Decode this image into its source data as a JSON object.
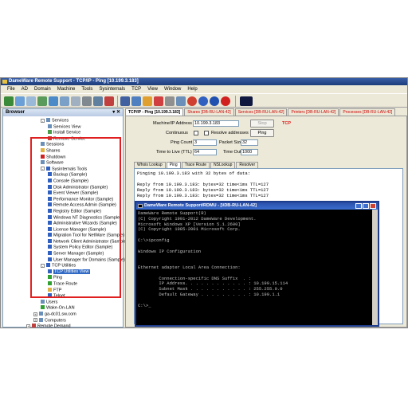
{
  "window": {
    "title": "DameWare Remote Support - TCP/IP - Ping [10.199.3.183]"
  },
  "menu": [
    "File",
    "AD",
    "Domain",
    "Machine",
    "Tools",
    "Sysinternals",
    "TCP",
    "View",
    "Window",
    "Help"
  ],
  "sidebar": {
    "title": "Browser",
    "pane_controls": "▾ ✕",
    "items": [
      {
        "label": "Services",
        "indent": 1,
        "expander": "-",
        "icon": "services-icon",
        "icon_color": "#6a8fb8"
      },
      {
        "label": "Services View",
        "indent": 2,
        "icon": "services-view-icon",
        "icon_color": "#6a8fb8"
      },
      {
        "label": "Install Service",
        "indent": 2,
        "icon": "install-service-icon",
        "icon_color": "#4a9a4a"
      },
      {
        "label": "Remove Service",
        "indent": 2,
        "icon": "remove-service-icon",
        "icon_color": "#c04040"
      },
      {
        "label": "Sessions",
        "indent": 1,
        "icon": "sessions-icon",
        "icon_color": "#6a8fb8"
      },
      {
        "label": "Shares",
        "indent": 1,
        "icon": "shares-icon",
        "icon_color": "#e0b040"
      },
      {
        "label": "Shutdown",
        "indent": 1,
        "icon": "shutdown-icon",
        "icon_color": "#d02020"
      },
      {
        "label": "Software",
        "indent": 1,
        "icon": "software-icon",
        "icon_color": "#6a8fb8"
      },
      {
        "label": "Sysinternals Tools",
        "indent": 1,
        "expander": "-",
        "icon": "sysinternals-icon",
        "icon_color": "#3060c0"
      },
      {
        "label": "Backup (Sample)",
        "indent": 2,
        "icon": "tool-icon",
        "icon_color": "#3060c0"
      },
      {
        "label": "Console (Sample)",
        "indent": 2,
        "icon": "tool-icon",
        "icon_color": "#3060c0"
      },
      {
        "label": "Disk Administrator (Sample)",
        "indent": 2,
        "icon": "tool-icon",
        "icon_color": "#3060c0"
      },
      {
        "label": "Event Viewer (Sample)",
        "indent": 2,
        "icon": "tool-icon",
        "icon_color": "#3060c0"
      },
      {
        "label": "Performance Monitor (Sample)",
        "indent": 2,
        "icon": "tool-icon",
        "icon_color": "#3060c0"
      },
      {
        "label": "Remote Access Admin (Sample)",
        "indent": 2,
        "icon": "tool-icon",
        "icon_color": "#3060c0"
      },
      {
        "label": "Registry Editor (Sample)",
        "indent": 2,
        "icon": "tool-icon",
        "icon_color": "#3060c0"
      },
      {
        "label": "Windows NT Diagnostics (Sample)",
        "indent": 2,
        "icon": "tool-icon",
        "icon_color": "#3060c0"
      },
      {
        "label": "Administrative Wizards (Sample)",
        "indent": 2,
        "icon": "tool-icon",
        "icon_color": "#3060c0"
      },
      {
        "label": "License Manager (Sample)",
        "indent": 2,
        "icon": "tool-icon",
        "icon_color": "#3060c0"
      },
      {
        "label": "Migration Tool for NetWare (Sample)",
        "indent": 2,
        "icon": "tool-icon",
        "icon_color": "#3060c0"
      },
      {
        "label": "Network Client Administrator (Sample)",
        "indent": 2,
        "icon": "tool-icon",
        "icon_color": "#3060c0"
      },
      {
        "label": "System Policy Editor (Sample)",
        "indent": 2,
        "icon": "tool-icon",
        "icon_color": "#3060c0"
      },
      {
        "label": "Server Manager (Sample)",
        "indent": 2,
        "icon": "tool-icon",
        "icon_color": "#3060c0"
      },
      {
        "label": "User Manager for Domains (Sample)",
        "indent": 2,
        "icon": "tool-icon",
        "icon_color": "#3060c0"
      },
      {
        "label": "TCP Utilities",
        "indent": 1,
        "expander": "-",
        "icon": "tcp-utilities-icon",
        "icon_color": "#3060c0"
      },
      {
        "label": "TCP Utilities View",
        "indent": 2,
        "icon": "tcp-view-icon",
        "icon_color": "#3060c0",
        "selected": true
      },
      {
        "label": "Ping",
        "indent": 2,
        "icon": "ping-icon",
        "icon_color": "#30a030"
      },
      {
        "label": "Trace Route",
        "indent": 2,
        "icon": "trace-route-icon",
        "icon_color": "#30a030"
      },
      {
        "label": "FTP",
        "indent": 2,
        "icon": "ftp-icon",
        "icon_color": "#e0b040"
      },
      {
        "label": "Telnet",
        "indent": 2,
        "icon": "telnet-icon",
        "icon_color": "#3060c0"
      },
      {
        "label": "Users",
        "indent": 1,
        "icon": "users-icon",
        "icon_color": "#6a8fb8"
      },
      {
        "label": "Wake-On-LAN",
        "indent": 1,
        "icon": "wake-on-lan-icon",
        "icon_color": "#30a030"
      },
      {
        "label": "ga-dc01.sw.com",
        "indent": 0,
        "expander": "+",
        "icon": "computer-icon",
        "icon_color": "#6a8fb8"
      },
      {
        "label": "Computers",
        "indent": 0,
        "expander": "+",
        "icon": "computers-icon",
        "icon_color": "#6a8fb8"
      },
      {
        "label": "Remote Demand",
        "indent": -1,
        "expander": "+",
        "icon": "remote-demand-icon",
        "icon_color": "#c04040"
      }
    ]
  },
  "tabs": [
    {
      "label": "TCP/IP - Ping [10.199.3.183]",
      "active": true
    },
    {
      "label": "Shares [DB-RU-LAN-42]"
    },
    {
      "label": "Services [DB-RU-LAN-42]"
    },
    {
      "label": "Printers [DB-RU-LAN-42]"
    },
    {
      "label": "Processes [DB-RU-LAN-42]"
    }
  ],
  "ping": {
    "machine_label": "Machine/IP Address",
    "machine_value": "10.199.3.183",
    "stop_label": "Stop",
    "tcp_label": "TCP",
    "continuous_label": "Continuous",
    "resolve_label": "Resolve addresses",
    "ping_button": "Ping",
    "ping_count_label": "Ping Count",
    "ping_count_value": "3",
    "packet_size_label": "Packet Size",
    "packet_size_value": "32",
    "ttl_label": "Time to Live (TTL)",
    "ttl_value": "64",
    "timeout_label": "Time Out",
    "timeout_value": "1000"
  },
  "subtabs": [
    "Whois Lookup",
    "Ping",
    "Trace Route",
    "NSLookup",
    "Resolver"
  ],
  "output_lines": [
    "Pinging 10.199.3.183 with 32 bytes of data:",
    "",
    "Reply from 10.199.3.183: bytes=32 time<1ms TTL=127",
    "Reply from 10.199.3.183: bytes=32 time<1ms TTL=127",
    "Reply from 10.199.3.183: bytes=32 time<1ms TTL=127"
  ],
  "terminal": {
    "title": "DameWare Remote Support/RDMU - [\\\\DB-RU-LAN-42]",
    "lines": [
      "DameWare Remote Support(R)",
      "(C) Copyright 1991-2012 DameWare Development.",
      "Microsoft Windows XP [Version 5.1.2600]",
      "(C) Copyright 1985-2001 Microsoft Corp.",
      "",
      "C:\\>ipconfig",
      "",
      "Windows IP Configuration",
      "",
      "",
      "Ethernet adapter Local Area Connection:",
      "",
      "        Connection-specific DNS Suffix  . :",
      "        IP Address. . . . . . . . . . . . : 10.199.15.114",
      "        Subnet Mask . . . . . . . . . . . : 255.255.0.0",
      "        Default Gateway . . . . . . . . . : 10.199.1.1",
      "",
      "C:\\>_"
    ]
  },
  "colors": {
    "highlight_box": "#e02020",
    "tcp_label": "#e02020",
    "selection": "#316ac5"
  }
}
